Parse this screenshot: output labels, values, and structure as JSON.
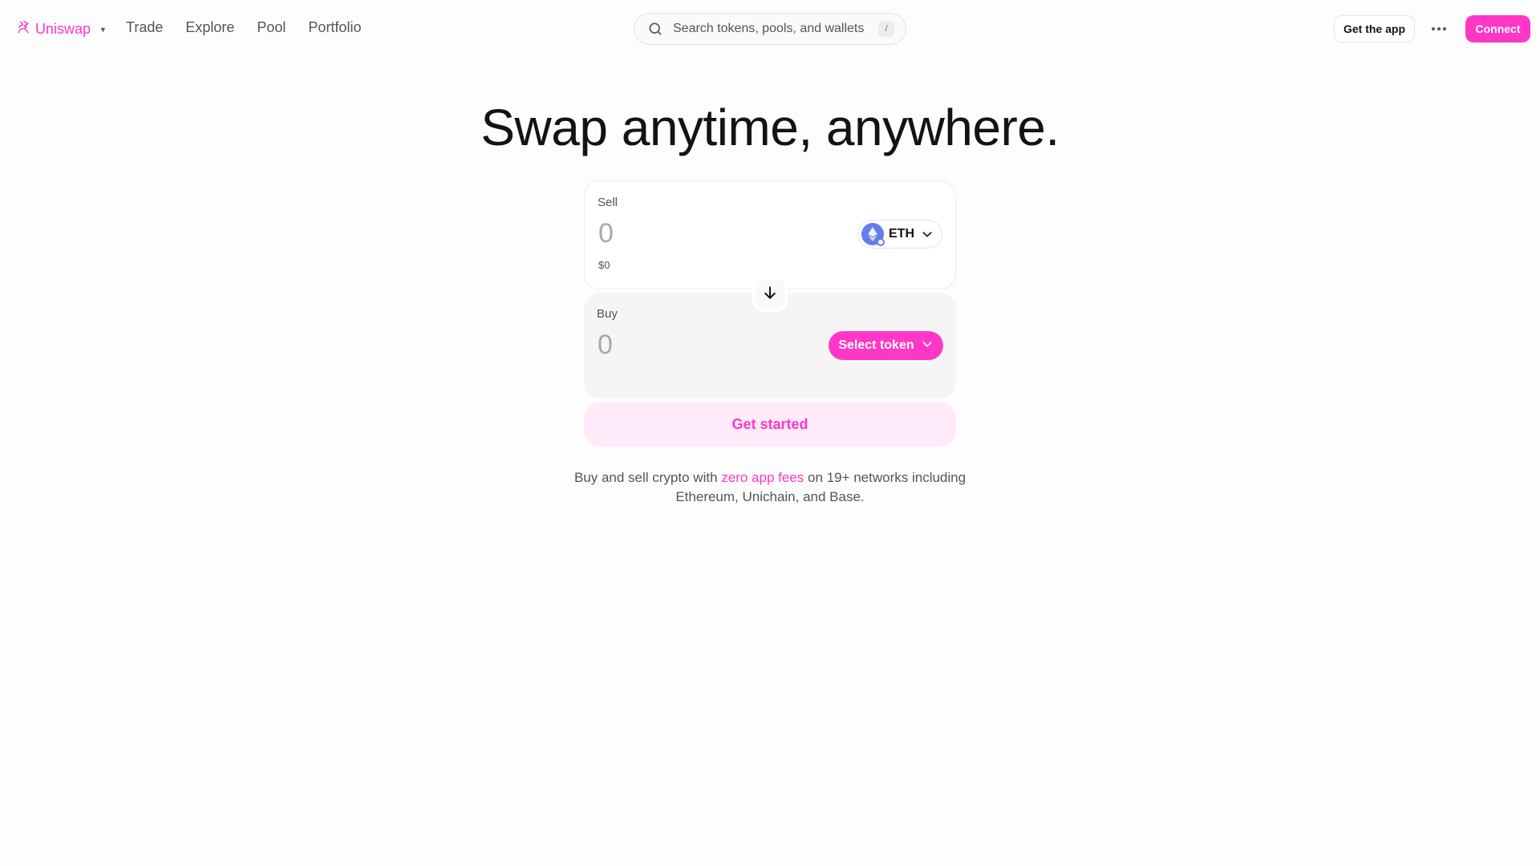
{
  "header": {
    "brand": "Uniswap",
    "nav": [
      "Trade",
      "Explore",
      "Pool",
      "Portfolio"
    ],
    "search_placeholder": "Search tokens, pools, and wallets",
    "search_shortcut": "/",
    "get_app_label": "Get the app",
    "connect_label": "Connect"
  },
  "hero": {
    "title": "Swap anytime, anywhere."
  },
  "swap": {
    "sell": {
      "label": "Sell",
      "amount": "0",
      "usd_value": "$0",
      "token": "ETH"
    },
    "buy": {
      "label": "Buy",
      "amount": "0",
      "select_label": "Select token"
    },
    "cta_label": "Get started"
  },
  "tagline": {
    "before": "Buy and sell crypto with",
    "link": "zero app fees",
    "after": "on 19+ networks including Ethereum, Unichain, and Base."
  },
  "colors": {
    "accent": "#ff37c7",
    "accent_soft": "#ffeaf9",
    "eth": "#627eea"
  }
}
